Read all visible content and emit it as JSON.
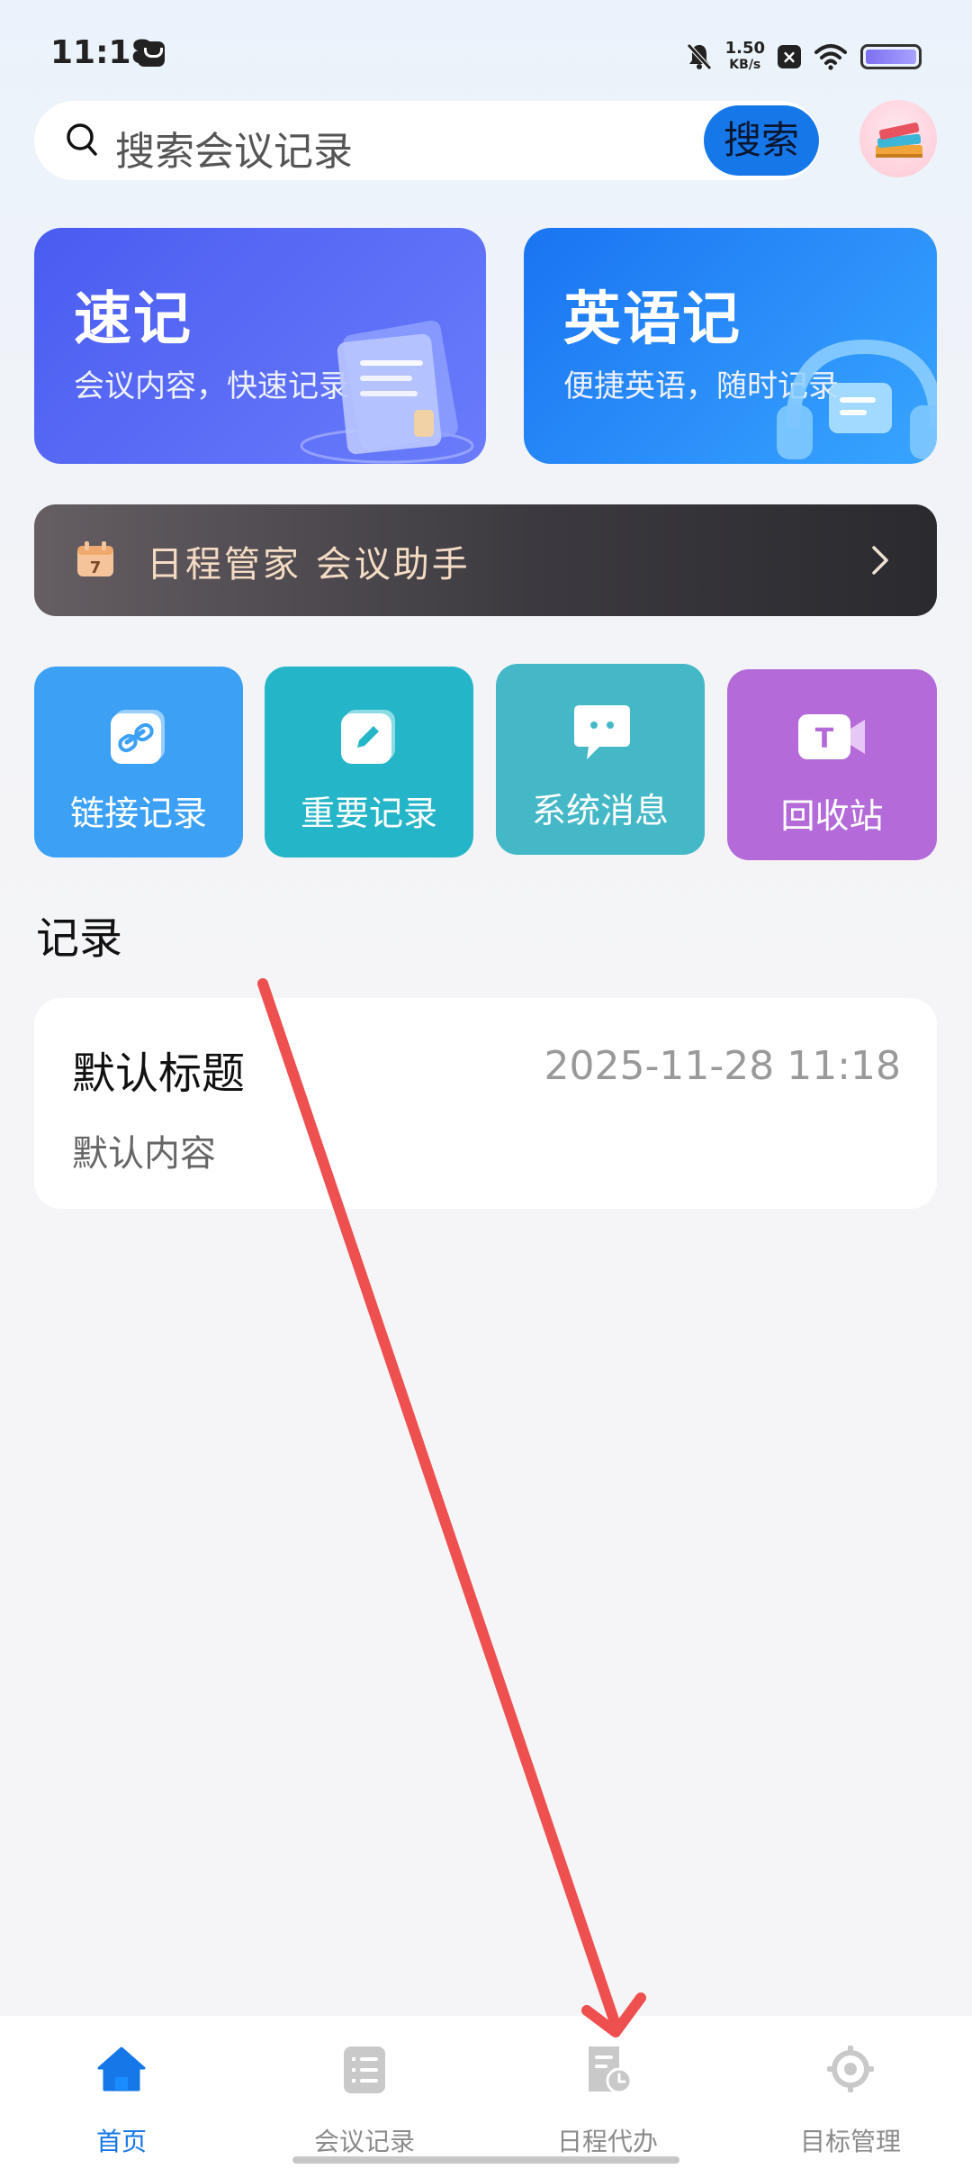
{
  "status_bar": {
    "time": "11:18",
    "net_speed_value": "1.50",
    "net_speed_unit": "KB/s"
  },
  "search": {
    "placeholder": "搜索会议记录",
    "button_label": "搜索"
  },
  "feature_cards": [
    {
      "title": "速记",
      "subtitle": "会议内容，快速记录",
      "color": "#4a5cf0"
    },
    {
      "title": "英语记",
      "subtitle": "便捷英语，随时记录",
      "color": "#1a74f2"
    }
  ],
  "banner": {
    "icon_number": "7",
    "text": "日程管家 会议助手"
  },
  "quick_actions": [
    {
      "label": "链接记录",
      "icon": "link-icon",
      "color": "#3ca1f5"
    },
    {
      "label": "重要记录",
      "icon": "pencil-icon",
      "color": "#25b5c8"
    },
    {
      "label": "系统消息",
      "icon": "chat-bubble-icon",
      "color": "#45b8c8"
    },
    {
      "label": "回收站",
      "icon": "video-t-icon",
      "icon_text": "T",
      "color": "#b46ad9"
    }
  ],
  "records_section": {
    "title": "记录",
    "items": [
      {
        "title": "默认标题",
        "time": "2025-11-28 11:18",
        "content": "默认内容"
      }
    ]
  },
  "tab_bar": {
    "active_color": "#1677e8",
    "tabs": [
      {
        "label": "首页",
        "icon": "home-icon",
        "active": true
      },
      {
        "label": "会议记录",
        "icon": "list-icon",
        "active": false
      },
      {
        "label": "日程代办",
        "icon": "schedule-todo-icon",
        "active": false
      },
      {
        "label": "目标管理",
        "icon": "target-icon",
        "active": false
      }
    ]
  }
}
